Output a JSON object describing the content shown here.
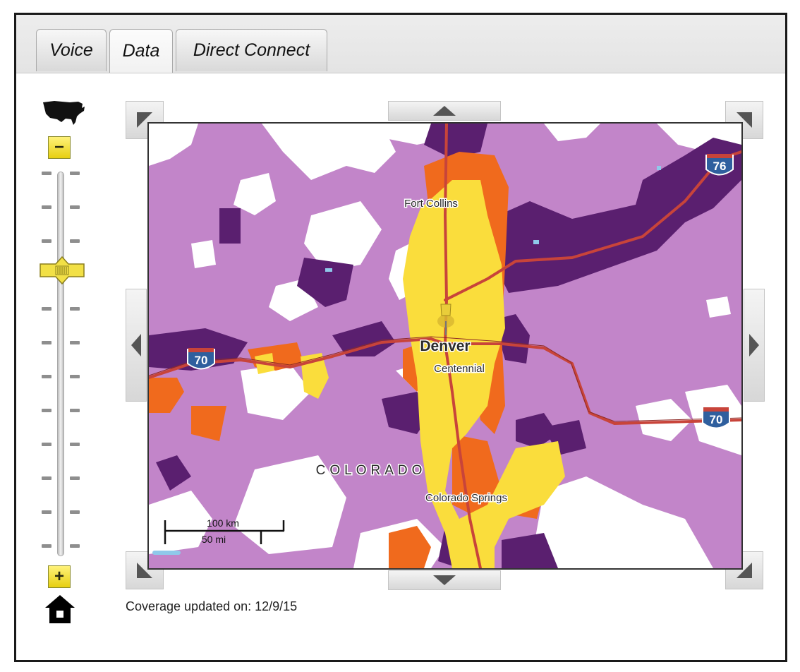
{
  "tabs": [
    {
      "label": "Voice",
      "active": false
    },
    {
      "label": "Data",
      "active": true
    },
    {
      "label": "Direct Connect",
      "active": false
    }
  ],
  "zoom": {
    "out_label": "−",
    "in_label": "+",
    "level_fraction": 0.27,
    "icons": [
      "us-map-icon",
      "home-icon"
    ]
  },
  "map": {
    "place_labels": {
      "fort_collins": "Fort Collins",
      "denver": "Denver",
      "centennial": "Centennial",
      "colorado": "COLORADO",
      "colorado_springs": "Colorado Springs"
    },
    "highway_shields": {
      "i76": "76",
      "i70_west": "70",
      "i70_east": "70"
    },
    "scale": {
      "km": "100 km",
      "mi": "50 mi"
    },
    "colors": {
      "base": "#c285c9",
      "strong": "#5a1f6f",
      "orange": "#f06a1d",
      "yellow": "#fadd3c",
      "road": "#c8443a",
      "shield": "#2f5f9e"
    },
    "nav_buttons": [
      "pan-north",
      "pan-south",
      "pan-west",
      "pan-east",
      "pan-northwest",
      "pan-northeast",
      "pan-southwest",
      "pan-southeast"
    ]
  },
  "footer": {
    "coverage_text": "Coverage updated on: 12/9/15"
  }
}
